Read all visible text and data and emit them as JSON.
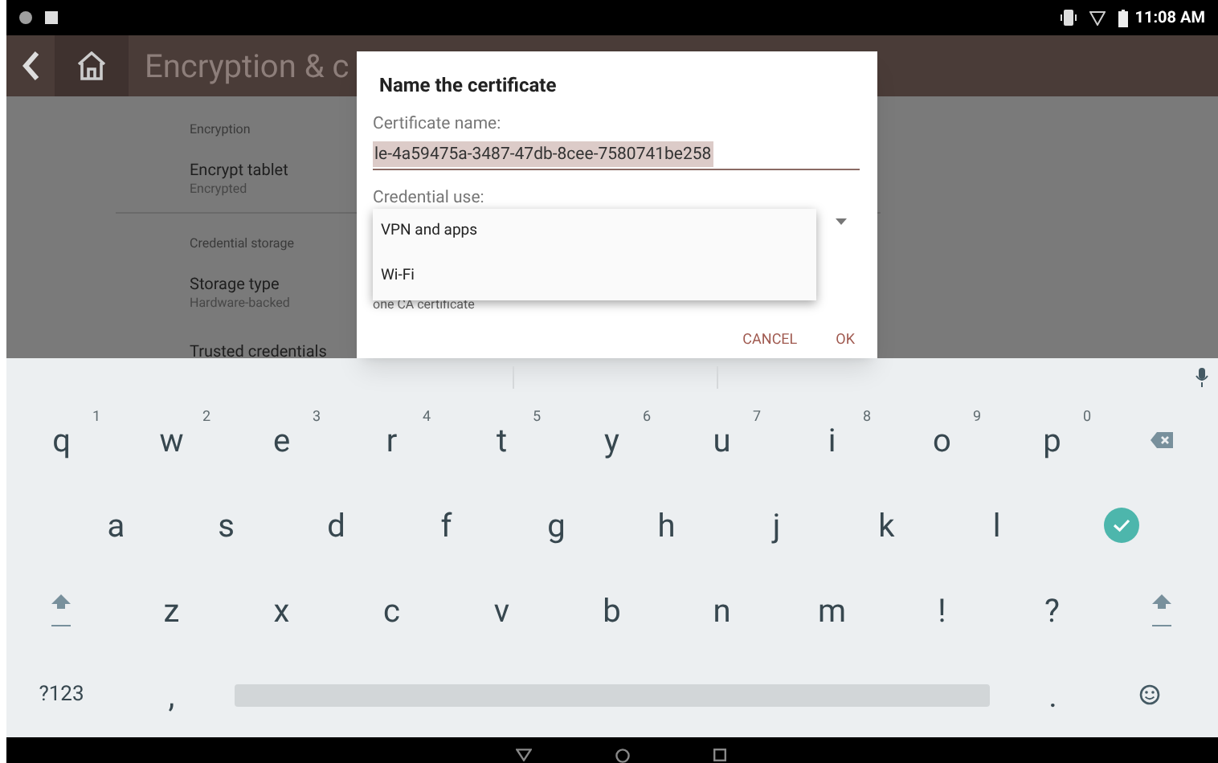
{
  "status_bar": {
    "time": "11:08 AM"
  },
  "app_bar": {
    "title": "Encryption & c"
  },
  "settings": [
    {
      "kind": "header",
      "text": "Encryption"
    },
    {
      "kind": "item",
      "title": "Encrypt tablet",
      "summary": "Encrypted"
    },
    {
      "kind": "divider"
    },
    {
      "kind": "header",
      "text": "Credential storage"
    },
    {
      "kind": "item",
      "title": "Storage type",
      "summary": "Hardware-backed"
    },
    {
      "kind": "item",
      "title": "Trusted credentials"
    }
  ],
  "dialog": {
    "title": "Name the certificate",
    "name_label": "Certificate name:",
    "name_value": "le-4a59475a-3487-47db-8cee-7580741be258",
    "name_selected": true,
    "use_label": "Credential use:",
    "note": "one CA certificate",
    "buttons": [
      "CANCEL",
      "OK"
    ]
  },
  "dropdown": {
    "options": [
      {
        "label": "VPN and apps"
      },
      {
        "label": "Wi-Fi"
      }
    ]
  },
  "keyboard": {
    "rows": [
      [
        {
          "kind": "key",
          "label": "q",
          "hint": "1"
        },
        {
          "kind": "key",
          "label": "w",
          "hint": "2"
        },
        {
          "kind": "key",
          "label": "e",
          "hint": "3"
        },
        {
          "kind": "key",
          "label": "r",
          "hint": "4"
        },
        {
          "kind": "key",
          "label": "t",
          "hint": "5"
        },
        {
          "kind": "key",
          "label": "y",
          "hint": "6"
        },
        {
          "kind": "key",
          "label": "u",
          "hint": "7"
        },
        {
          "kind": "key",
          "label": "i",
          "hint": "8"
        },
        {
          "kind": "key",
          "label": "o",
          "hint": "9"
        },
        {
          "kind": "key",
          "label": "p",
          "hint": "0"
        },
        {
          "kind": "backspace"
        }
      ],
      [
        {
          "kind": "key",
          "label": "a"
        },
        {
          "kind": "key",
          "label": "s"
        },
        {
          "kind": "key",
          "label": "d"
        },
        {
          "kind": "key",
          "label": "f"
        },
        {
          "kind": "key",
          "label": "g"
        },
        {
          "kind": "key",
          "label": "h"
        },
        {
          "kind": "key",
          "label": "j"
        },
        {
          "kind": "key",
          "label": "k"
        },
        {
          "kind": "key",
          "label": "l"
        },
        {
          "kind": "enter"
        }
      ],
      [
        {
          "kind": "shift"
        },
        {
          "kind": "key",
          "label": "z"
        },
        {
          "kind": "key",
          "label": "x"
        },
        {
          "kind": "key",
          "label": "c"
        },
        {
          "kind": "key",
          "label": "v"
        },
        {
          "kind": "key",
          "label": "b"
        },
        {
          "kind": "key",
          "label": "n"
        },
        {
          "kind": "key",
          "label": "m"
        },
        {
          "kind": "key",
          "label": "!"
        },
        {
          "kind": "key",
          "label": "?"
        },
        {
          "kind": "shift"
        }
      ]
    ],
    "bottom_row": {
      "mode_label": "?123",
      "comma": ",",
      "period": "."
    }
  }
}
